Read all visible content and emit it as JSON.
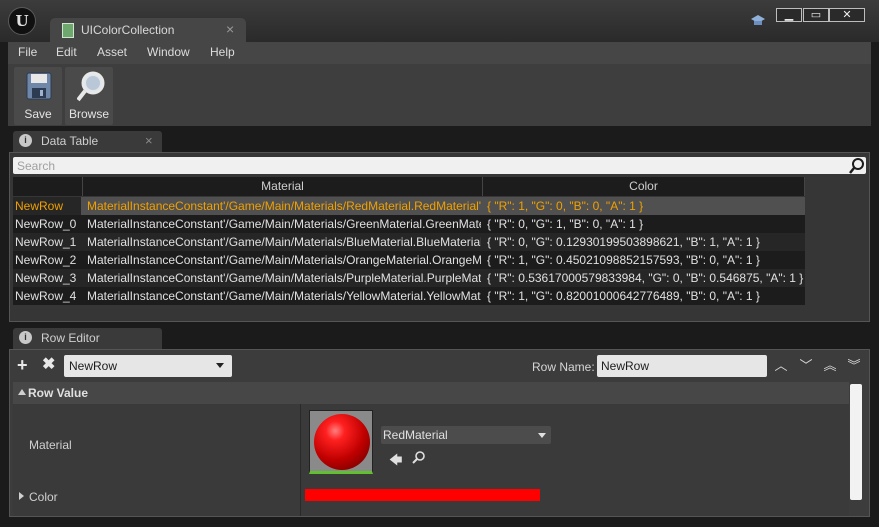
{
  "window": {
    "app_logo": "U",
    "tab_title": "UIColorCollection",
    "tab_close": "×",
    "min_label": "▁",
    "max_label": "▭",
    "close_label": "✕"
  },
  "menu": [
    "File",
    "Edit",
    "Asset",
    "Window",
    "Help"
  ],
  "toolbar": {
    "save_label": "Save",
    "browse_label": "Browse"
  },
  "data_table": {
    "tab_label": "Data Table",
    "tab_close": "×",
    "search_placeholder": "Search",
    "columns": [
      "Material",
      "Color"
    ],
    "rows": [
      {
        "name": "NewRow",
        "material": "MaterialInstanceConstant'/Game/Main/Materials/RedMaterial.RedMaterial'",
        "color": "{ \"R\": 1, \"G\": 0, \"B\": 0, \"A\": 1 }"
      },
      {
        "name": "NewRow_0",
        "material": "MaterialInstanceConstant'/Game/Main/Materials/GreenMaterial.GreenMaterial'",
        "color": "{ \"R\": 0, \"G\": 1, \"B\": 0, \"A\": 1 }"
      },
      {
        "name": "NewRow_1",
        "material": "MaterialInstanceConstant'/Game/Main/Materials/BlueMaterial.BlueMaterial'",
        "color": "{ \"R\": 0, \"G\": 0.12930199503898621, \"B\": 1, \"A\": 1 }"
      },
      {
        "name": "NewRow_2",
        "material": "MaterialInstanceConstant'/Game/Main/Materials/OrangeMaterial.OrangeMaterial'",
        "color": "{ \"R\": 1, \"G\": 0.45021098852157593, \"B\": 0, \"A\": 1 }"
      },
      {
        "name": "NewRow_3",
        "material": "MaterialInstanceConstant'/Game/Main/Materials/PurpleMaterial.PurpleMaterial'",
        "color": "{ \"R\": 0.53617000579833984, \"G\": 0, \"B\": 0.546875, \"A\": 1 }"
      },
      {
        "name": "NewRow_4",
        "material": "MaterialInstanceConstant'/Game/Main/Materials/YellowMaterial.YellowMaterial'",
        "color": "{ \"R\": 1, \"G\": 0.82001000642776489, \"B\": 0, \"A\": 1 }"
      }
    ]
  },
  "row_editor": {
    "tab_label": "Row Editor",
    "tab_close": "",
    "add_label": "+",
    "remove_label": "✖",
    "selected_row": "NewRow",
    "row_name_label": "Row Name:",
    "row_name_value": "NewRow",
    "nav": [
      "︿",
      "﹀",
      "︽",
      "︾"
    ],
    "section_label": "Row Value",
    "material_label": "Material",
    "material_value": "RedMaterial",
    "use_icon": "🡄",
    "color_label": "Color",
    "color_value": "#ff0000"
  },
  "colors": {
    "selected_row_text": "#f0a000",
    "thumbnail_border": "#60c030"
  }
}
